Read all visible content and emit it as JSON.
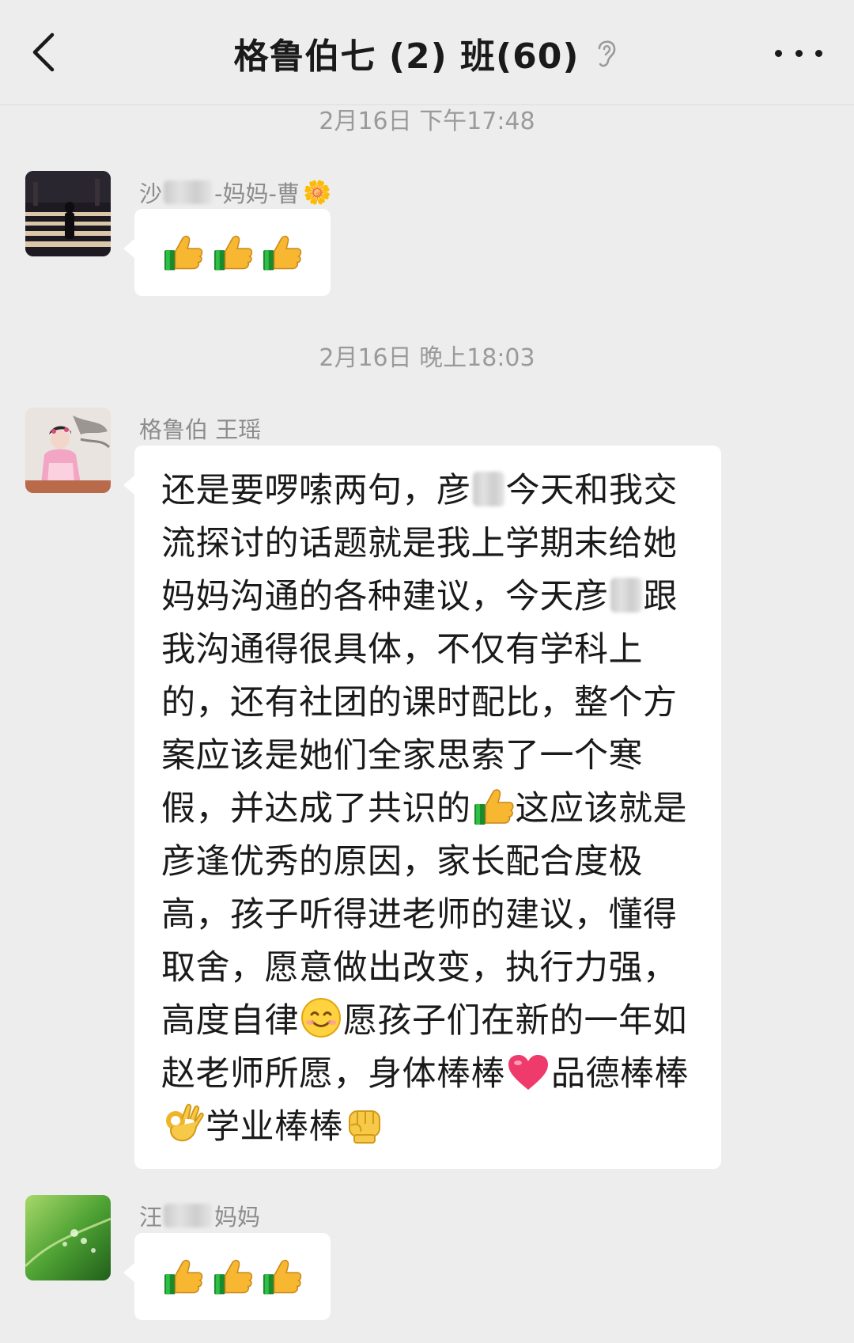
{
  "header": {
    "title": "格鲁伯七 (2) 班(60)",
    "back_icon": "chevron-left-icon",
    "mute_icon": "ear-icon",
    "more_icon": "more-dots-icon"
  },
  "messages": [
    {
      "timestamp": "2月16日 下午17:48",
      "sender_prefix": "沙",
      "sender_suffix": "-妈妈-曹",
      "sender_emoji": "🌼",
      "content": [
        "👍",
        "👍",
        "👍"
      ]
    },
    {
      "timestamp": "2月16日 晚上18:03",
      "sender": "格鲁伯 王瑶",
      "text_parts": [
        "还是要啰嗦两句，彦",
        "今天和我交流探讨的话题就是我上学期末给她妈妈沟通的各种建议，今天彦",
        "跟我沟通得很具体，不仅有学科上的，还有社团的课时配比，整个方案应该是她们全家思索了一个寒假，并达成了共识的",
        "这应该就是彦逢优秀的原因，家长配合度极高，孩子听得进老师的建议，懂得取舍，愿意做出改变，执行力强，高度自律",
        "愿孩子们在新的一年如赵老师所愿，身体棒棒",
        "品德棒棒",
        "学业棒棒"
      ],
      "emojis": [
        "👍",
        "😊",
        "❤️",
        "👌",
        "✊"
      ]
    },
    {
      "sender_prefix": "汪",
      "sender_suffix": "妈妈",
      "content": [
        "👍",
        "👍",
        "👍"
      ]
    }
  ]
}
